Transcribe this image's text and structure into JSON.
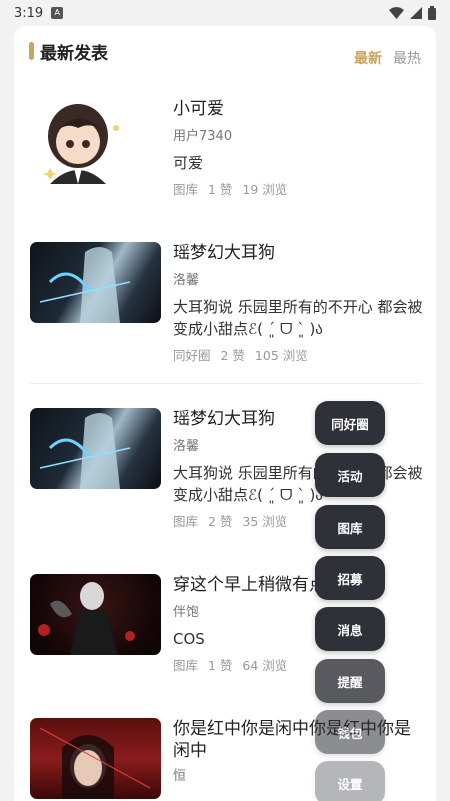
{
  "status_bar": {
    "time": "3:19",
    "notification_letter": "A"
  },
  "section": {
    "title": "最新发表",
    "tabs": [
      {
        "label": "最新",
        "active": true
      },
      {
        "label": "最热",
        "active": false
      }
    ]
  },
  "posts": [
    {
      "title": "小可爱",
      "author": "用户7340",
      "excerpt": "可爱",
      "category": "图库",
      "likes": "1 赞",
      "views": "19 浏览"
    },
    {
      "title": "瑶梦幻大耳狗",
      "author": "洛馨",
      "excerpt": "大耳狗说 乐园里所有的不开心 都会被变成小甜点ℰ( ´͈ ᗜ `͈ )ა",
      "category": "同好圈",
      "likes": "2 赞",
      "views": "105 浏览"
    },
    {
      "title": "瑶梦幻大耳狗",
      "author": "洛馨",
      "excerpt": "大耳狗说 乐园里所有的不开心 都会被变成小甜点ℰ( ´͈ ᗜ `͈ )ა",
      "category": "图库",
      "likes": "2 赞",
      "views": "35 浏览"
    },
    {
      "title": "穿这个早上稍微有点热",
      "author": "伴饱",
      "excerpt": "COS",
      "category": "图库",
      "likes": "1 赞",
      "views": "64 浏览"
    },
    {
      "title": "你是红中你是闲中你是红中你是闲中",
      "author": "恒",
      "excerpt": "",
      "category": "",
      "likes": "",
      "views": ""
    }
  ],
  "fab_menu": [
    "同好圈",
    "活动",
    "图库",
    "招募",
    "消息",
    "提醒",
    "钱包",
    "设置"
  ],
  "colors": {
    "accent": "#c9a45a",
    "fab_bg": "#2f3139"
  }
}
